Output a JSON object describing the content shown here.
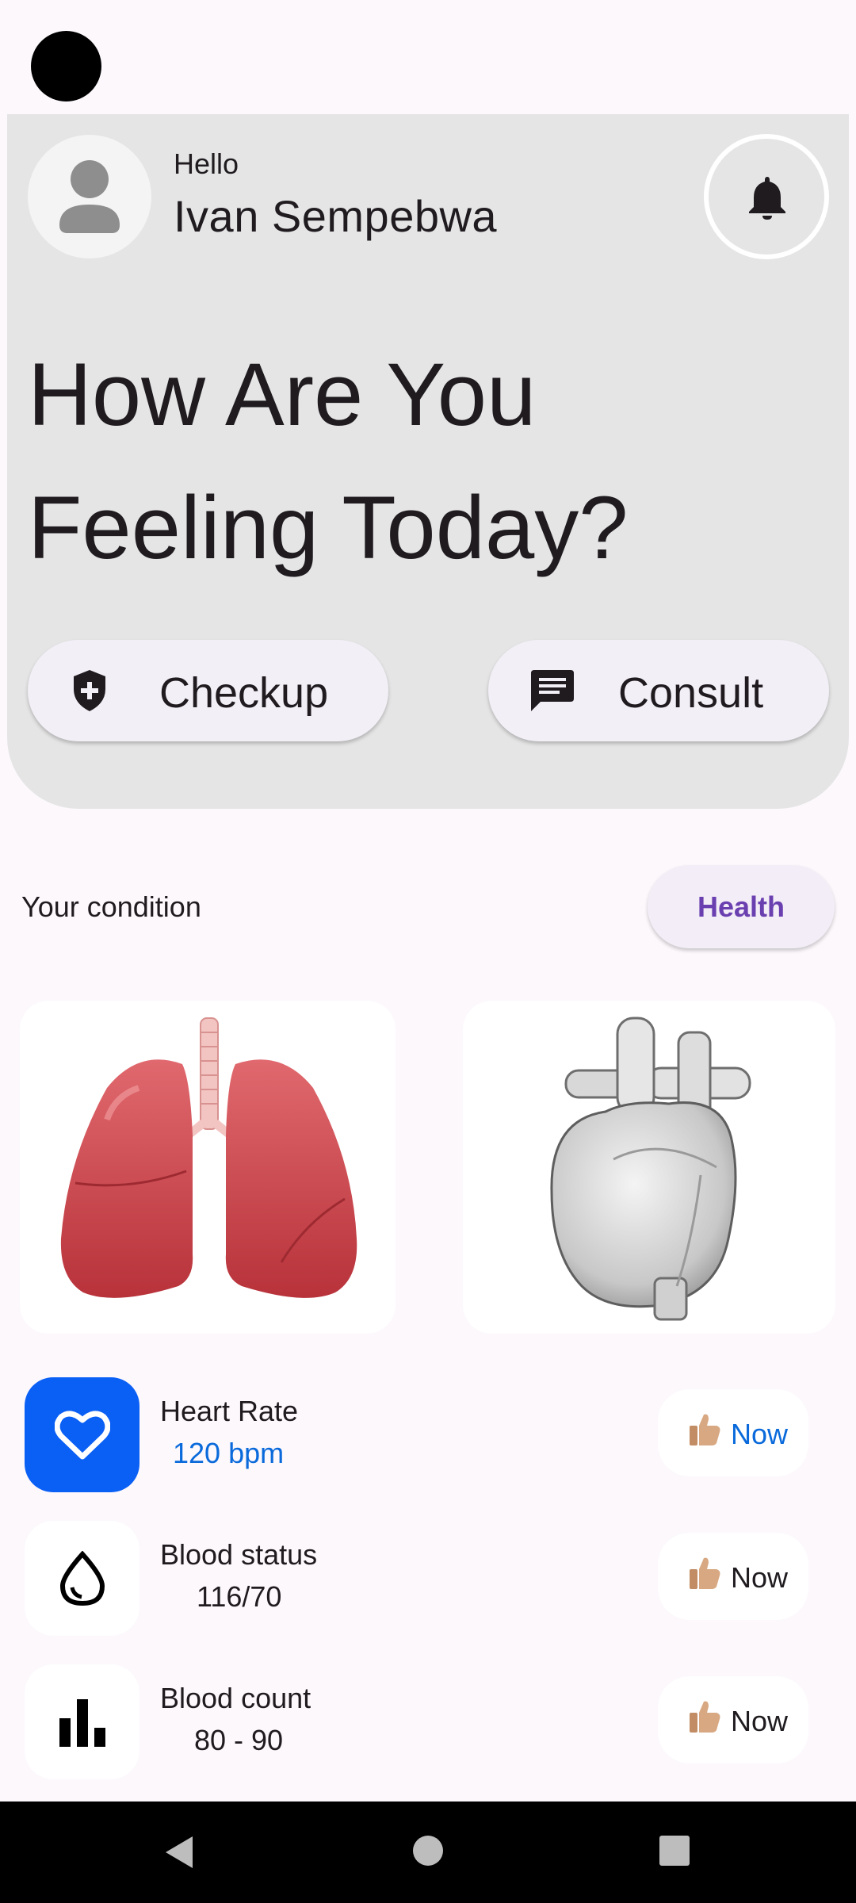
{
  "user": {
    "greeting": "Hello",
    "name": "Ivan Sempebwa"
  },
  "headline": {
    "line1": "How Are You",
    "line2": "Feeling Today?"
  },
  "actions": {
    "checkup_label": "Checkup",
    "consult_label": "Consult"
  },
  "condition": {
    "title": "Your condition",
    "chip_label": "Health"
  },
  "organs": [
    {
      "name": "lungs-image"
    },
    {
      "name": "heart-image"
    }
  ],
  "metrics": [
    {
      "label": "Heart Rate",
      "value": "120 bpm",
      "status": "Now",
      "icon": "heart-icon"
    },
    {
      "label": "Blood status",
      "value": "116/70",
      "status": "Now",
      "icon": "drop-icon"
    },
    {
      "label": "Blood count",
      "value": "80 - 90",
      "status": "Now",
      "icon": "bar-chart-icon"
    }
  ],
  "colors": {
    "accent_blue": "#0A5FF5",
    "chip_text": "#6A3FB0",
    "header_bg": "#E5E5E5",
    "page_bg": "#FCF8FC"
  }
}
